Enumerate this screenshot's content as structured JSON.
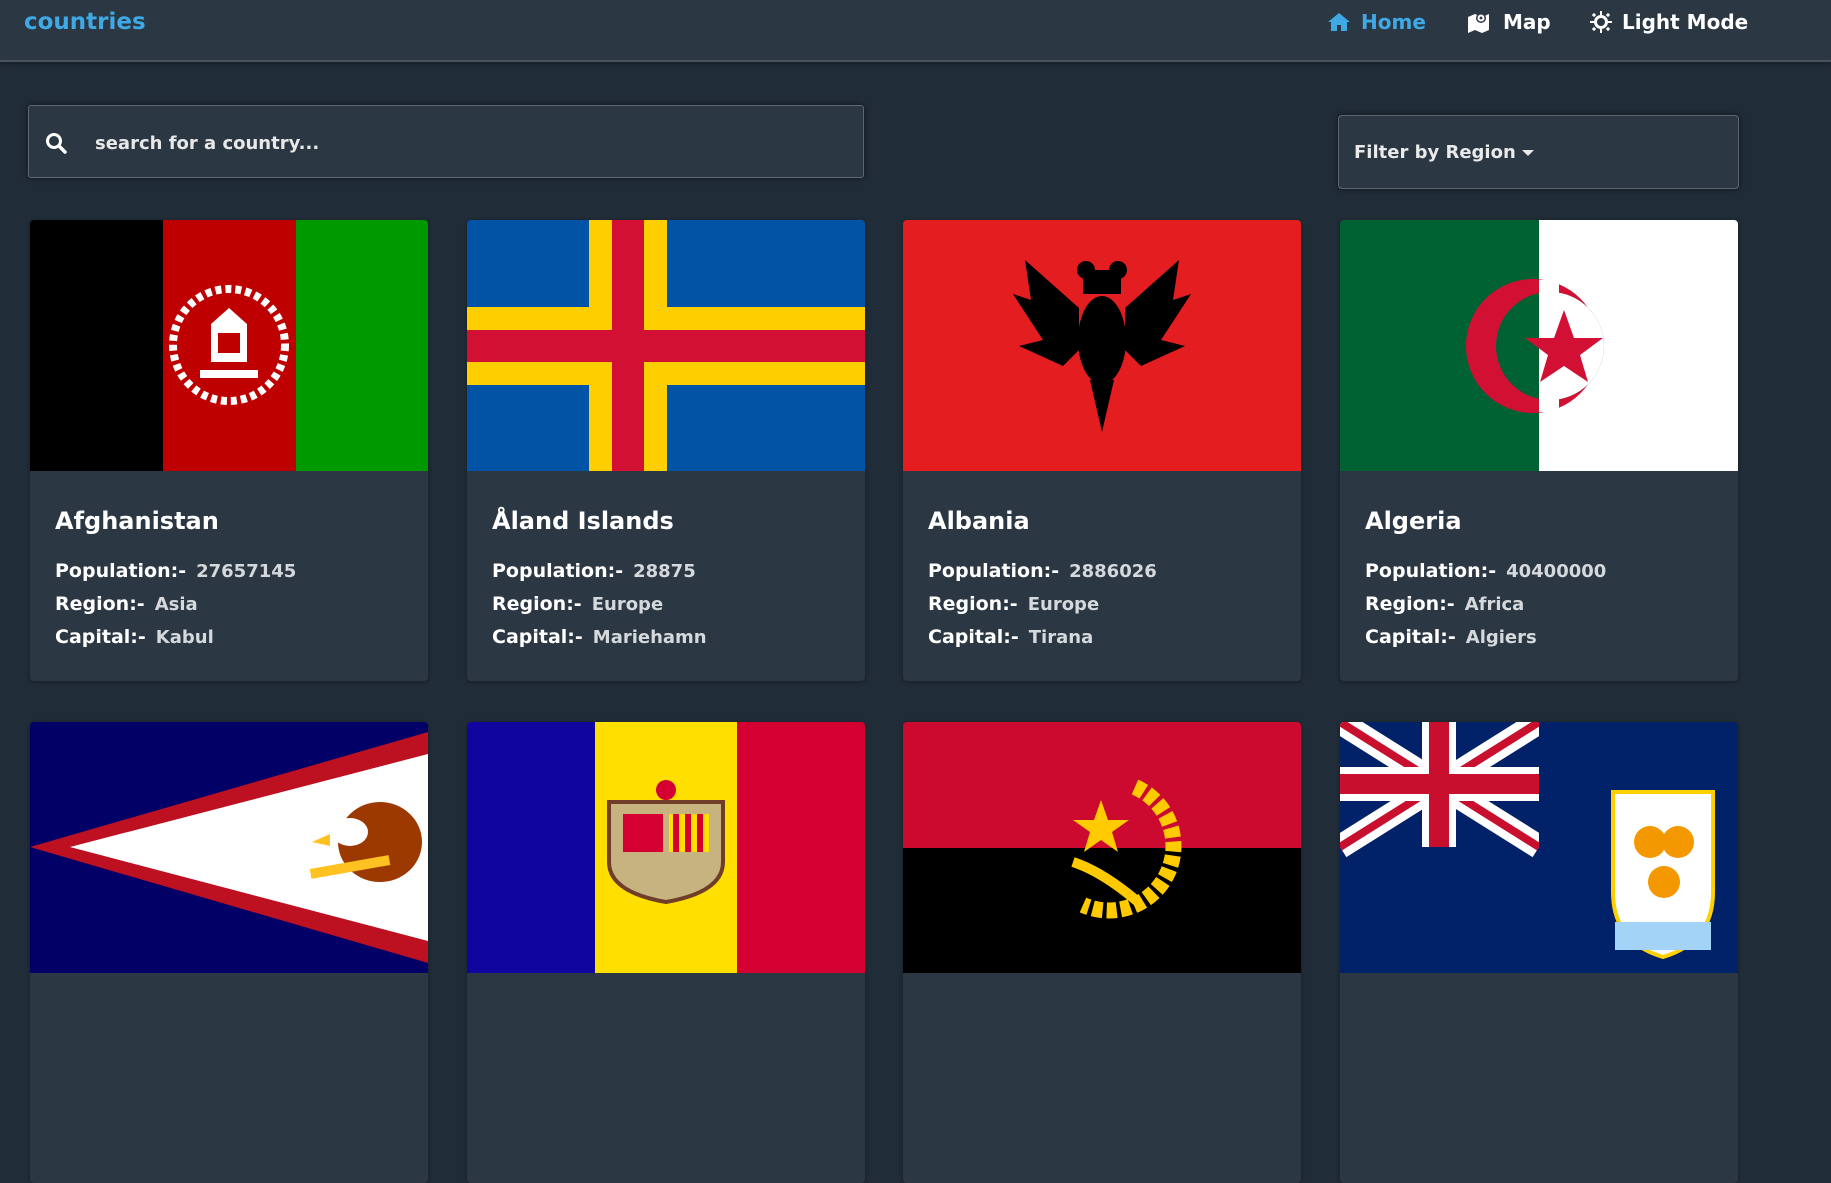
{
  "navbar": {
    "brand": "countries",
    "links": [
      {
        "label": "Home",
        "icon": "home-icon",
        "active": true
      },
      {
        "label": "Map",
        "icon": "map-icon",
        "active": false
      },
      {
        "label": "Light Mode",
        "icon": "sun-icon",
        "active": false
      }
    ]
  },
  "search": {
    "placeholder": "search for a country...",
    "value": ""
  },
  "filter": {
    "label": "Filter by Region"
  },
  "labels": {
    "population": "Population:-",
    "region": "Region:-",
    "capital": "Capital:-"
  },
  "countries": [
    {
      "name": "Afghanistan",
      "population": "27657145",
      "region": "Asia",
      "capital": "Kabul",
      "flag": "afghanistan-flag"
    },
    {
      "name": "Åland Islands",
      "population": "28875",
      "region": "Europe",
      "capital": "Mariehamn",
      "flag": "aland-islands-flag"
    },
    {
      "name": "Albania",
      "population": "2886026",
      "region": "Europe",
      "capital": "Tirana",
      "flag": "albania-flag"
    },
    {
      "name": "Algeria",
      "population": "40400000",
      "region": "Africa",
      "capital": "Algiers",
      "flag": "algeria-flag"
    },
    {
      "flag": "american-samoa-flag"
    },
    {
      "flag": "andorra-flag"
    },
    {
      "flag": "angola-flag"
    },
    {
      "flag": "anguilla-flag"
    }
  ],
  "colors": {
    "background": "#202c37",
    "surface": "#2b3743",
    "accent": "#3fa9e6"
  }
}
